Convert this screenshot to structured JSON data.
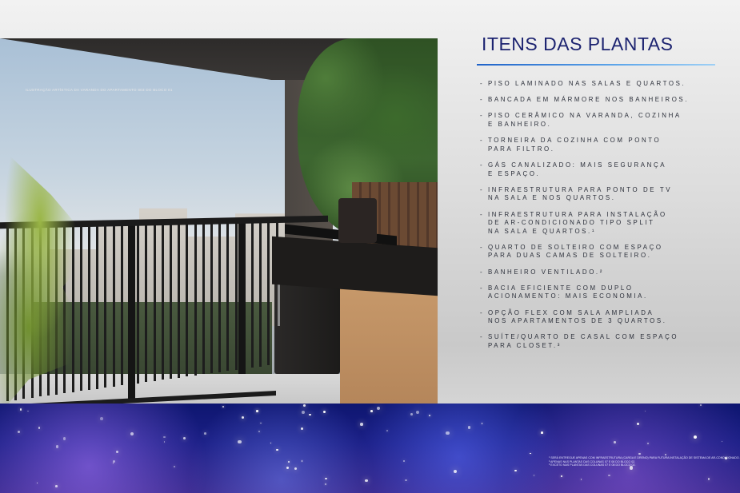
{
  "photo": {
    "caption": "Ilustração artística da varanda do apartamento 803 do bloco 01"
  },
  "panel": {
    "title": "ITENS DAS PLANTAS",
    "dash": "-",
    "items": [
      [
        "PISO LAMINADO NAS SALAS E QUARTOS."
      ],
      [
        "BANCADA EM MÁRMORE NOS BANHEIROS."
      ],
      [
        "PISO CERÂMICO NA VARANDA, COZINHA",
        "E BANHEIRO."
      ],
      [
        "TORNEIRA DA COZINHA COM PONTO",
        "PARA FILTRO."
      ],
      [
        "GÁS CANALIZADO: MAIS SEGURANÇA",
        "E ESPAÇO."
      ],
      [
        "INFRAESTRUTURA PARA PONTO DE TV",
        "NA SALA E NOS QUARTOS."
      ],
      [
        "INFRAESTRUTURA PARA INSTALAÇÃO",
        "DE AR-CONDICIONADO TIPO SPLIT",
        "NA SALA E QUARTOS.¹"
      ],
      [
        "QUARTO DE SOLTEIRO COM ESPAÇO",
        "PARA DUAS CAMAS DE SOLTEIRO."
      ],
      [
        "BANHEIRO VENTILADO.²"
      ],
      [
        "BACIA EFICIENTE COM DUPLO",
        "ACIONAMENTO: MAIS ECONOMIA."
      ],
      [
        "OPÇÃO FLEX COM SALA AMPLIADA",
        "NOS APARTAMENTOS DE 3 QUARTOS."
      ],
      [
        "SUÍTE/QUARTO DE CASAL COM ESPAÇO",
        "PARA CLOSET.³"
      ]
    ]
  },
  "footnotes": [
    "¹ SERÁ ENTREGUE APENAS COM INFRAESTRUTURA (CARGA E DRENO) PARA FUTURA INSTALAÇÃO DE SISTEMA DE AR-CONDICIONADO.",
    "² APENAS NAS PLANTAS DAS COLUNAS 07 E 08 DO BLOCO 02.",
    "³ EXCETO NAS PLANTAS DAS COLUNAS 07 E 08 DO BLOCO 02."
  ],
  "colors": {
    "title": "#1c2370",
    "rule": "#3f8ee0",
    "text": "#2b2f3a",
    "glitter_base": "#1b1f86"
  }
}
